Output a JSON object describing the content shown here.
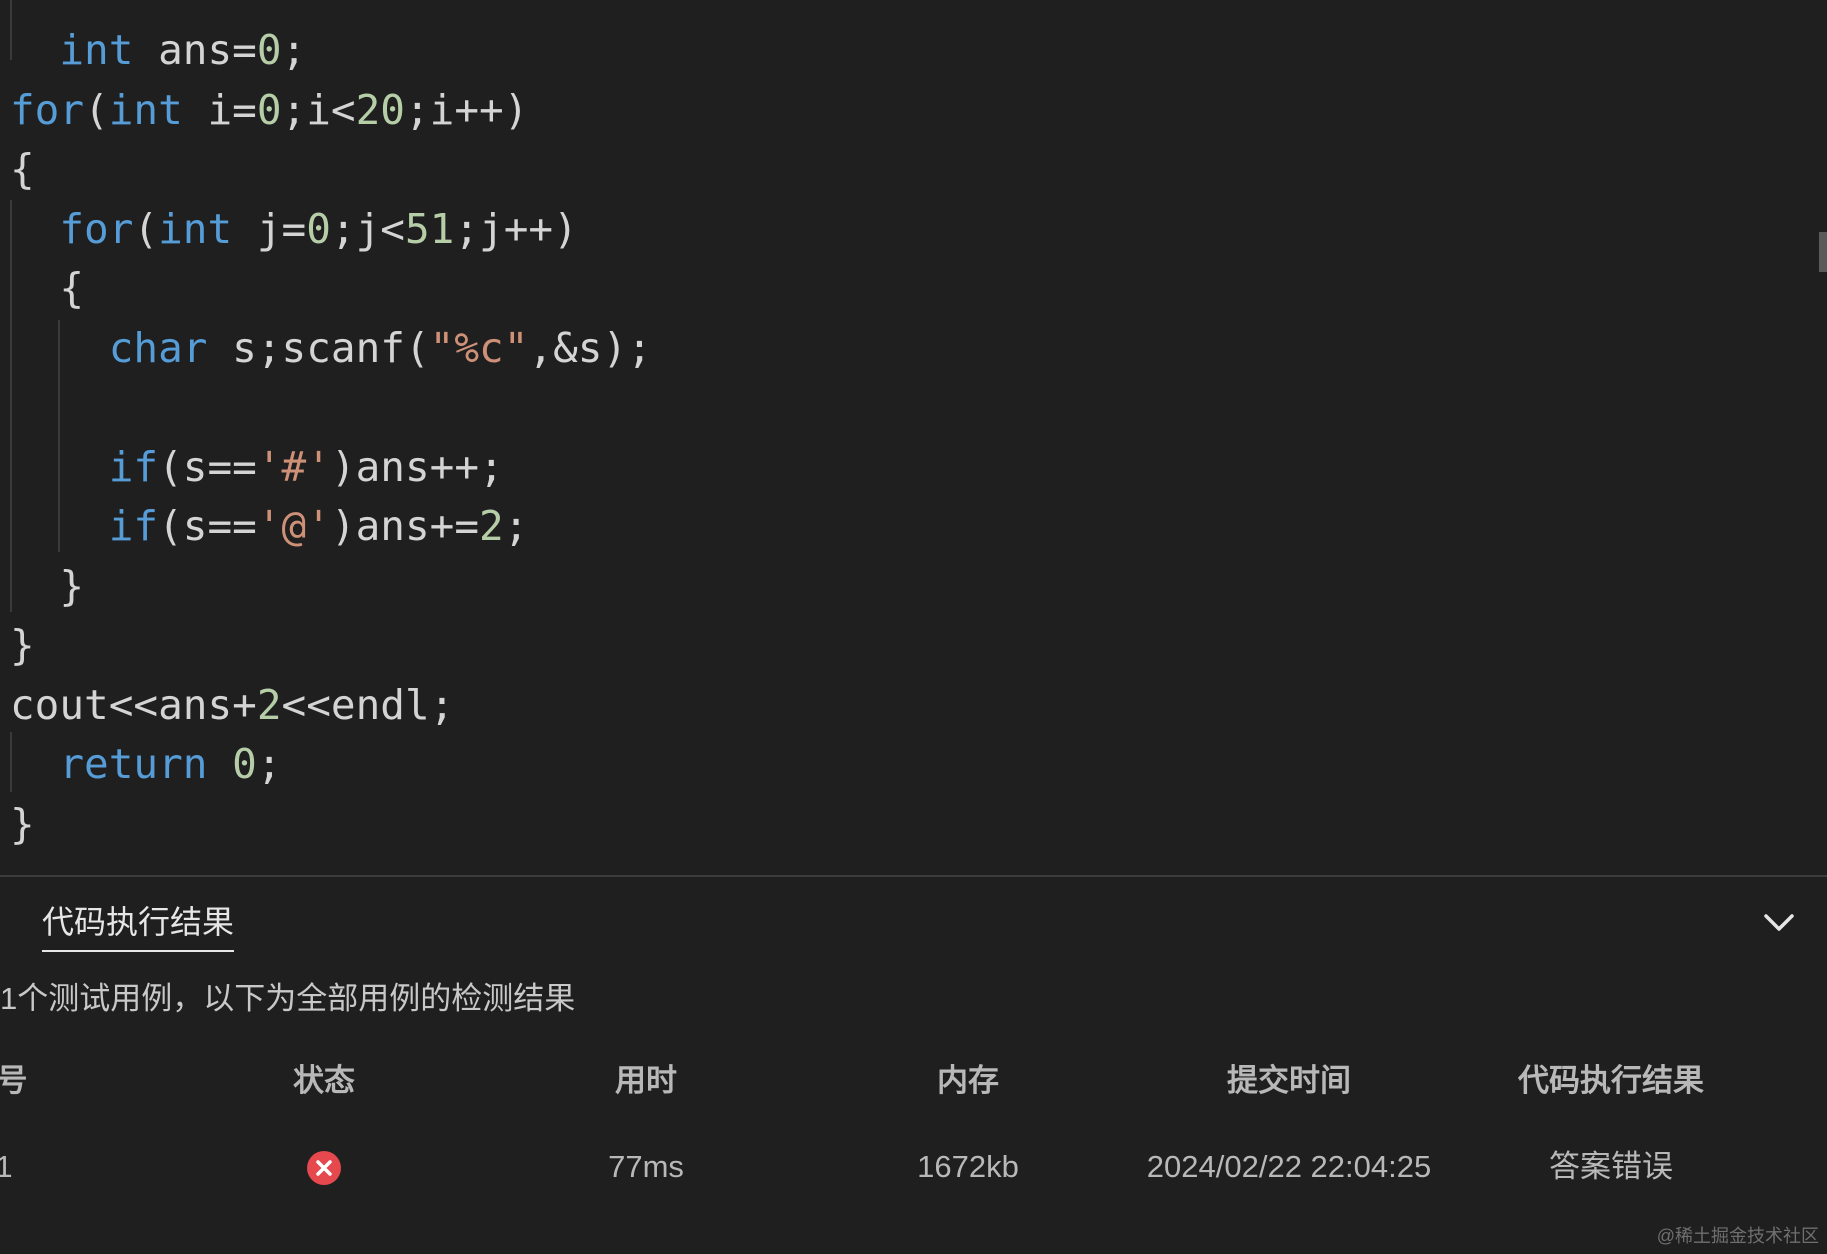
{
  "editor": {
    "lines": [
      [
        {
          "t": "  ",
          "c": "tk-id"
        },
        {
          "t": "int",
          "c": "tk-kw"
        },
        {
          "t": " ans=",
          "c": "tk-id"
        },
        {
          "t": "0",
          "c": "tk-num"
        },
        {
          "t": ";",
          "c": "tk-id"
        }
      ],
      [
        {
          "t": "for",
          "c": "tk-ctrl"
        },
        {
          "t": "(",
          "c": "tk-id"
        },
        {
          "t": "int",
          "c": "tk-kw"
        },
        {
          "t": " i=",
          "c": "tk-id"
        },
        {
          "t": "0",
          "c": "tk-num"
        },
        {
          "t": ";i<",
          "c": "tk-id"
        },
        {
          "t": "20",
          "c": "tk-num"
        },
        {
          "t": ";i++)",
          "c": "tk-id"
        }
      ],
      [
        {
          "t": "{",
          "c": "tk-id"
        }
      ],
      [
        {
          "t": "  ",
          "c": "tk-id"
        },
        {
          "t": "for",
          "c": "tk-ctrl"
        },
        {
          "t": "(",
          "c": "tk-id"
        },
        {
          "t": "int",
          "c": "tk-kw"
        },
        {
          "t": " j=",
          "c": "tk-id"
        },
        {
          "t": "0",
          "c": "tk-num"
        },
        {
          "t": ";j<",
          "c": "tk-id"
        },
        {
          "t": "51",
          "c": "tk-num"
        },
        {
          "t": ";j++)",
          "c": "tk-id"
        }
      ],
      [
        {
          "t": "  {",
          "c": "tk-id"
        }
      ],
      [
        {
          "t": "    ",
          "c": "tk-id"
        },
        {
          "t": "char",
          "c": "tk-kw"
        },
        {
          "t": " s;scanf(",
          "c": "tk-id"
        },
        {
          "t": "\"%c\"",
          "c": "tk-str"
        },
        {
          "t": ",&s);",
          "c": "tk-id"
        }
      ],
      [
        {
          "t": "",
          "c": "tk-id"
        }
      ],
      [
        {
          "t": "    ",
          "c": "tk-id"
        },
        {
          "t": "if",
          "c": "tk-ctrl"
        },
        {
          "t": "(s==",
          "c": "tk-id"
        },
        {
          "t": "'#'",
          "c": "tk-str"
        },
        {
          "t": ")ans++;",
          "c": "tk-id"
        }
      ],
      [
        {
          "t": "    ",
          "c": "tk-id"
        },
        {
          "t": "if",
          "c": "tk-ctrl"
        },
        {
          "t": "(s==",
          "c": "tk-id"
        },
        {
          "t": "'@'",
          "c": "tk-str"
        },
        {
          "t": ")ans+=",
          "c": "tk-id"
        },
        {
          "t": "2",
          "c": "tk-num"
        },
        {
          "t": ";",
          "c": "tk-id"
        }
      ],
      [
        {
          "t": "  }",
          "c": "tk-id"
        }
      ],
      [
        {
          "t": "}",
          "c": "tk-id"
        }
      ],
      [
        {
          "t": "cout<<ans+",
          "c": "tk-id"
        },
        {
          "t": "2",
          "c": "tk-num"
        },
        {
          "t": "<<endl;",
          "c": "tk-id"
        }
      ],
      [
        {
          "t": "  ",
          "c": "tk-id"
        },
        {
          "t": "return",
          "c": "tk-ctrl"
        },
        {
          "t": " ",
          "c": "tk-id"
        },
        {
          "t": "0",
          "c": "tk-num"
        },
        {
          "t": ";",
          "c": "tk-id"
        }
      ],
      [
        {
          "t": "}",
          "c": "tk-id"
        }
      ]
    ]
  },
  "panel": {
    "tab_label": "代码执行结果",
    "summary": "1个测试用例，以下为全部用例的检测结果",
    "columns": [
      "号",
      "状态",
      "用时",
      "内存",
      "提交时间",
      "代码执行结果"
    ],
    "rows": [
      {
        "index": "1",
        "status": "error-icon",
        "time": "77ms",
        "memory": "1672kb",
        "submitted": "2024/02/22 22:04:25",
        "result": "答案错误"
      }
    ]
  },
  "watermark": "@稀土掘金技术社区",
  "colors": {
    "background": "#1f1f1f",
    "keyword": "#569cd6",
    "number": "#b5cea8",
    "string": "#ce9178",
    "text": "#d4d4d4",
    "error": "#e5484d"
  },
  "icons": {
    "collapse": "chevron-down-icon",
    "status": "error-x-icon"
  }
}
